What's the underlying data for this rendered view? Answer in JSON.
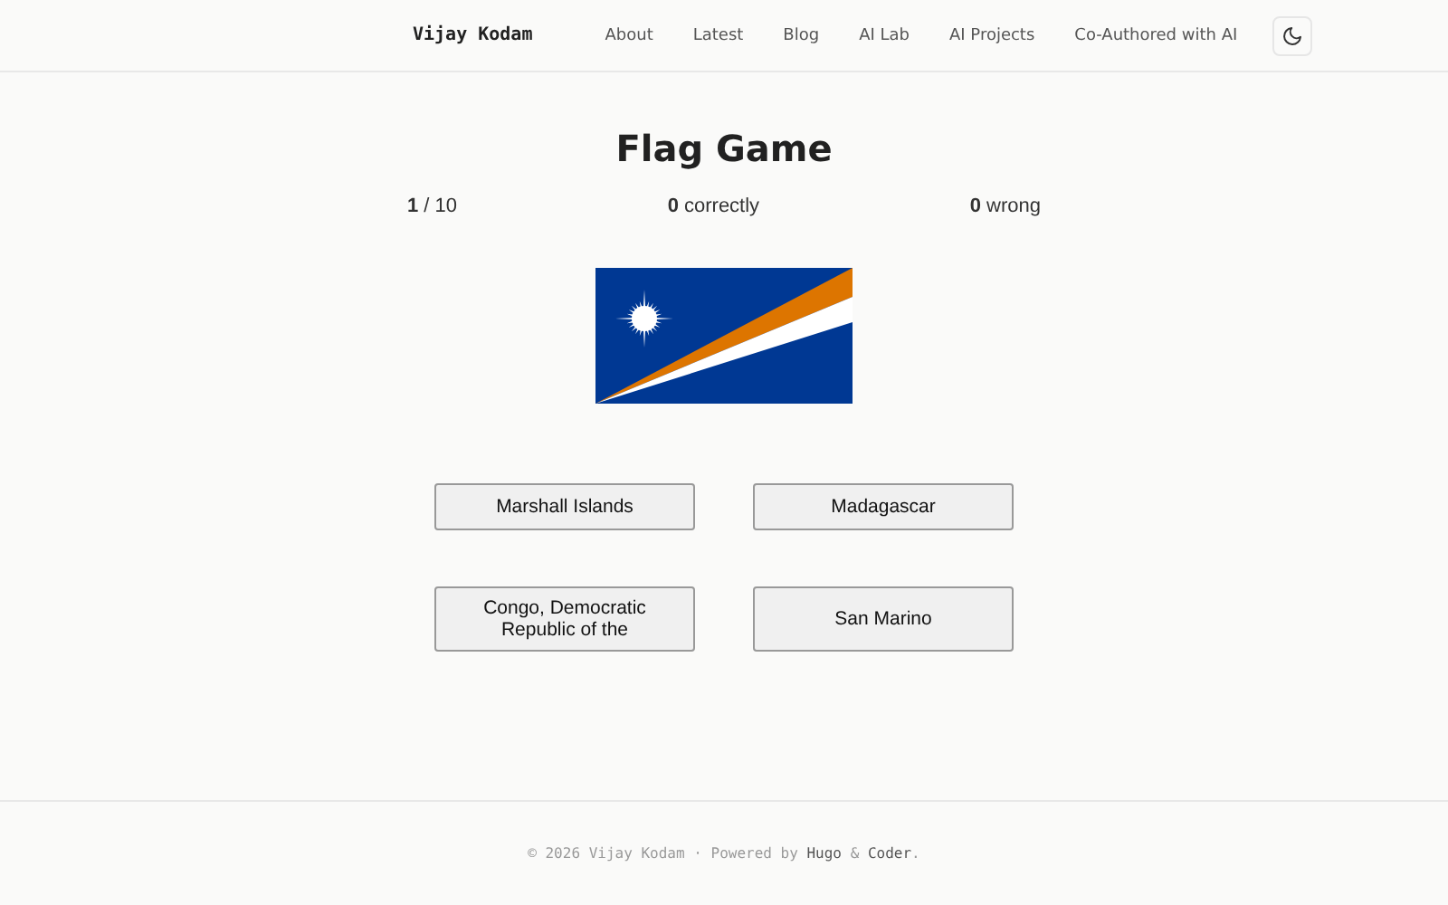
{
  "header": {
    "brand": "Vijay Kodam",
    "nav": [
      "About",
      "Latest",
      "Blog",
      "AI Lab",
      "AI Projects",
      "Co-Authored with AI"
    ]
  },
  "game": {
    "title": "Flag Game",
    "progress": {
      "current": "1",
      "total": "/ 10"
    },
    "correct": {
      "count": "0",
      "label": "correctly"
    },
    "wrong": {
      "count": "0",
      "label": "wrong"
    },
    "answers": [
      "Marshall Islands",
      "Madagascar",
      "Congo, Democratic Republic of the",
      "San Marino"
    ]
  },
  "footer": {
    "text": "© 2026 Vijay Kodam · Powered by ",
    "links": [
      {
        "text": "Hugo",
        "after": " & "
      },
      {
        "text": "Coder",
        "after": "."
      }
    ]
  }
}
